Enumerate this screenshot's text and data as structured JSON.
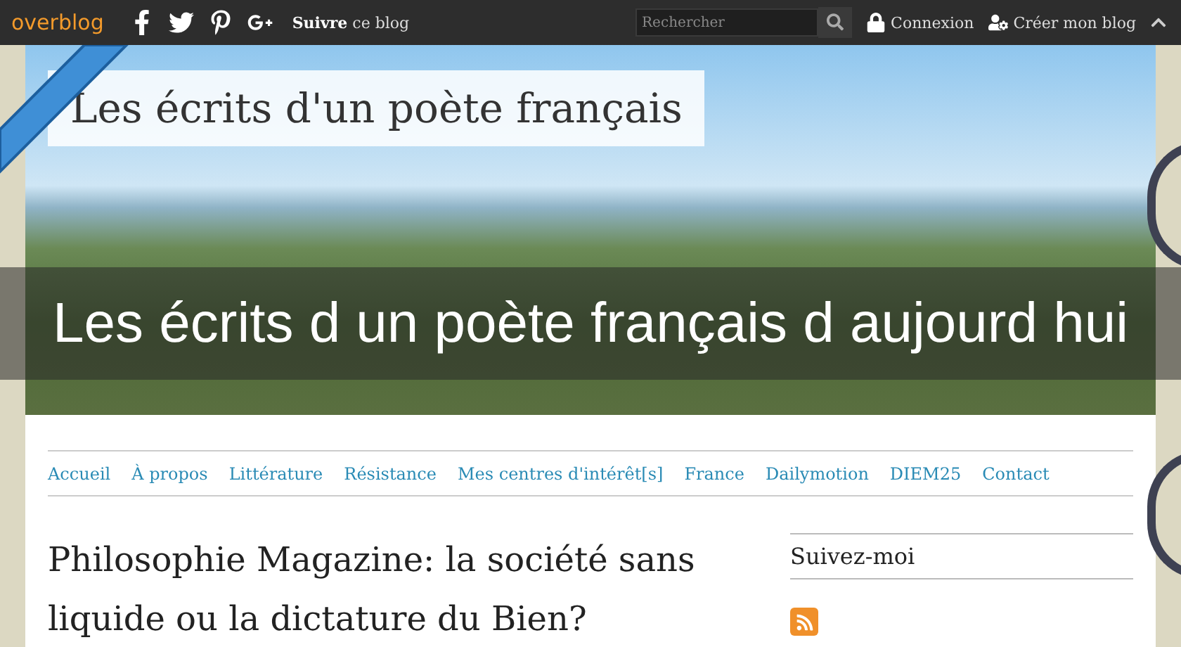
{
  "topbar": {
    "logo": "overblog",
    "follow_bold": "Suivre",
    "follow_rest": "ce blog",
    "search": {
      "placeholder": "Rechercher"
    },
    "login": "Connexion",
    "create": "Créer mon blog"
  },
  "header": {
    "blog_title": "Les écrits d'un poète français"
  },
  "overlay_title": "Les écrits d un poète français d aujourd hui",
  "nav": [
    {
      "label": "Accueil"
    },
    {
      "label": "À propos"
    },
    {
      "label": "Littérature"
    },
    {
      "label": "Résistance"
    },
    {
      "label": "Mes centres d'intérêt[s]"
    },
    {
      "label": "France"
    },
    {
      "label": "Dailymotion"
    },
    {
      "label": "DIEM25"
    },
    {
      "label": "Contact"
    }
  ],
  "article": {
    "title": "Philosophie Magazine: la société sans liquide ou la dictature du Bien?"
  },
  "sidebar": {
    "heading": "Suivez-moi"
  }
}
